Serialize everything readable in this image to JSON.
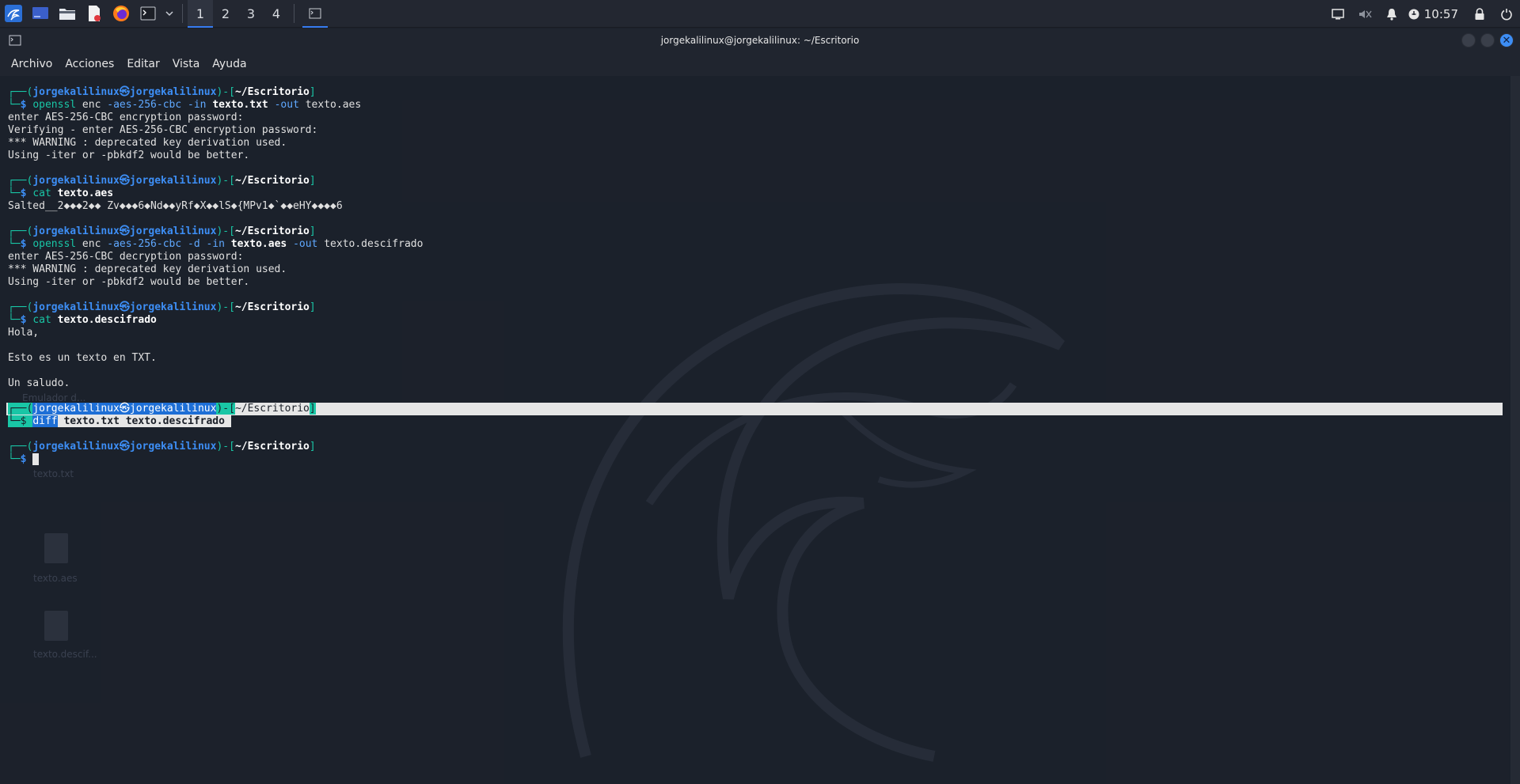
{
  "panel": {
    "workspaces": [
      "1",
      "2",
      "3",
      "4"
    ],
    "active_workspace": "1",
    "clock": "10:57"
  },
  "window": {
    "title": "jorgekalilinux@jorgekalilinux: ~/Escritorio",
    "menu": [
      "Archivo",
      "Acciones",
      "Editar",
      "Vista",
      "Ayuda"
    ]
  },
  "prompt": {
    "user": "jorgekalilinux",
    "at": "㉿",
    "host": "jorgekalilinux",
    "dir": "~/Escritorio",
    "symbol": "$"
  },
  "blocks": [
    {
      "cmd": "openssl",
      "rest": [
        {
          "t": " enc ",
          "c": "out"
        },
        {
          "t": "-aes-256-cbc",
          "c": "opt"
        },
        {
          "t": " ",
          "c": "out"
        },
        {
          "t": "-in",
          "c": "opt"
        },
        {
          "t": " ",
          "c": "out"
        },
        {
          "t": "texto.txt",
          "c": "bold"
        },
        {
          "t": " ",
          "c": "out"
        },
        {
          "t": "-out",
          "c": "opt"
        },
        {
          "t": " texto.aes",
          "c": "out"
        }
      ],
      "output": [
        "enter AES-256-CBC encryption password:",
        "Verifying - enter AES-256-CBC encryption password:",
        "*** WARNING : deprecated key derivation used.",
        "Using -iter or -pbkdf2 would be better."
      ]
    },
    {
      "cmd": "cat",
      "rest": [
        {
          "t": " ",
          "c": "out"
        },
        {
          "t": "texto.aes",
          "c": "bold"
        }
      ],
      "output": [
        "Salted__2◆◆◆2◆◆ Zv◆◆◆6◆Nd◆◆yRf◆X◆◆lS◆{MPv1◆`◆◆eHY◆◆◆◆6"
      ]
    },
    {
      "cmd": "openssl",
      "rest": [
        {
          "t": " enc ",
          "c": "out"
        },
        {
          "t": "-aes-256-cbc",
          "c": "opt"
        },
        {
          "t": " ",
          "c": "out"
        },
        {
          "t": "-d",
          "c": "opt"
        },
        {
          "t": " ",
          "c": "out"
        },
        {
          "t": "-in",
          "c": "opt"
        },
        {
          "t": " ",
          "c": "out"
        },
        {
          "t": "texto.aes",
          "c": "bold"
        },
        {
          "t": " ",
          "c": "out"
        },
        {
          "t": "-out",
          "c": "opt"
        },
        {
          "t": " texto.descifrado",
          "c": "out"
        }
      ],
      "output": [
        "enter AES-256-CBC decryption password:",
        "*** WARNING : deprecated key derivation used.",
        "Using -iter or -pbkdf2 would be better."
      ]
    },
    {
      "cmd": "cat",
      "rest": [
        {
          "t": " ",
          "c": "out"
        },
        {
          "t": "texto.descifrado",
          "c": "bold"
        }
      ],
      "output": [
        "Hola,",
        "",
        "Esto es un texto en TXT.",
        "",
        "Un saludo."
      ]
    }
  ],
  "selected_block": {
    "cmd": "diff",
    "args": " texto.txt texto.descifrado "
  },
  "desktop_icons": [
    "Emulador d...",
    "texto.txt",
    "texto.aes",
    "texto.descif..."
  ]
}
